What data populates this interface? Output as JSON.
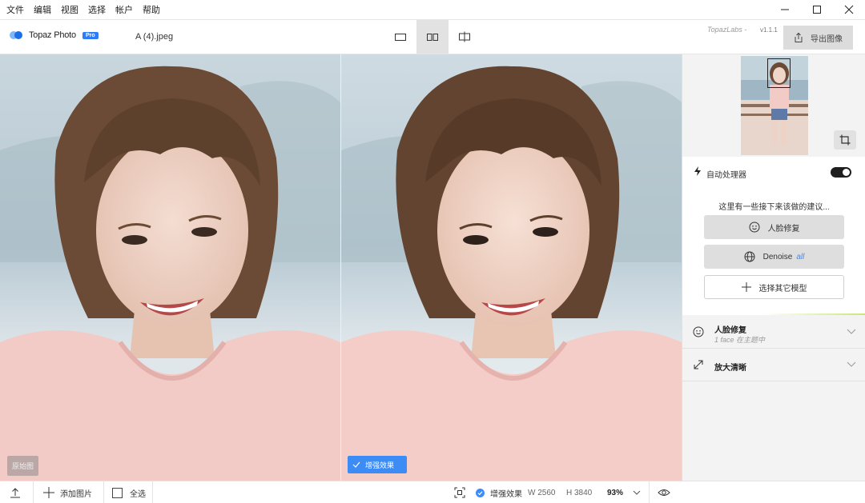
{
  "menu": [
    "文件",
    "编辑",
    "视图",
    "选择",
    "帐户",
    "帮助"
  ],
  "toolbar": {
    "logo_text": "Topaz Photo",
    "pro_badge": "Pro",
    "filename": "A (4).jpeg",
    "brand": "TopazLabs -",
    "version": "v1.1.1",
    "export_label": "导出图像"
  },
  "image_tags": {
    "original": "原始图",
    "enhanced": "增强效果"
  },
  "panel": {
    "auto_title": "自动处理器",
    "auto_enabled": true,
    "suggest_text": "这里有一些接下来该做的建议...",
    "face_button": "人脸修复",
    "denoise_button": "Denoise",
    "denoise_tag": "all",
    "choose_model": "选择其它模型",
    "sections": [
      {
        "title": "人脸修复",
        "sub": "1 face 在主题中",
        "icon": "face-icon"
      },
      {
        "title": "放大清晰",
        "sub": "",
        "icon": "expand-icon"
      }
    ]
  },
  "bottom": {
    "add_images": "添加图片",
    "select_all": "全选",
    "enhanced_label": "增强效果",
    "width": "W 2560",
    "height": "H 3840",
    "zoom": "93%"
  },
  "colors": {
    "accent": "#3d8cf5",
    "toggle_on": "#1e1e1e",
    "shirt": "#f3cbc6"
  }
}
